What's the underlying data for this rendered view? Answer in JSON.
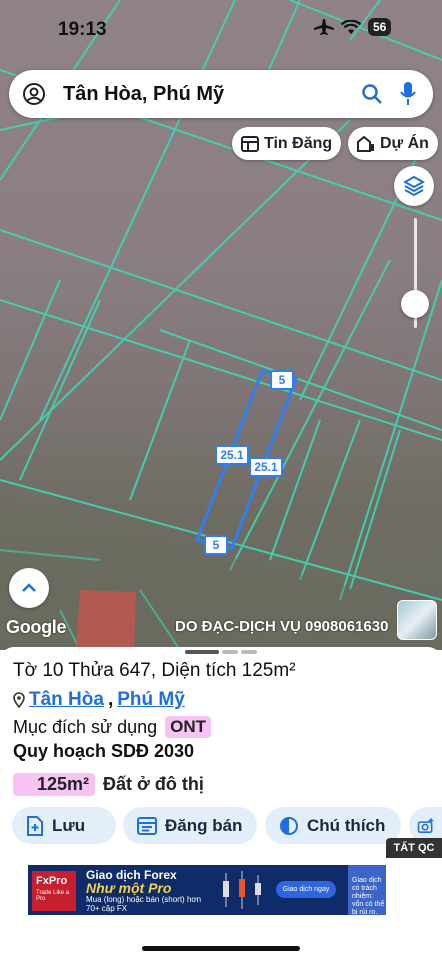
{
  "status_bar": {
    "time": "19:13",
    "battery": "56"
  },
  "search": {
    "query": "Tân Hòa, Phú Mỹ"
  },
  "chips": {
    "listings": "Tin Đăng",
    "projects": "Dự Án"
  },
  "map": {
    "parcel_labels": {
      "top": "5",
      "bottom": "5",
      "left_side": "25.1",
      "right_side": "25.1"
    },
    "google_label": "Google",
    "watermark": "DO ĐẠC-DỊCH VỤ 0908061630",
    "colors": {
      "parcel_line": "#3fd6b4",
      "selected_parcel": "#2f7ff2"
    }
  },
  "info": {
    "title": "Tờ 10 Thửa 647, Diện tích 125m²",
    "location": {
      "ward": "Tân Hòa",
      "separator": ",",
      "district": "Phú Mỹ"
    },
    "purpose_label": "Mục đích sử dụng",
    "purpose_code": "ONT",
    "plan_title": "Quy hoạch SDĐ 2030",
    "area_value": "125m²",
    "area_desc": "Đất ở đô thị"
  },
  "actions": {
    "save": "Lưu",
    "post": "Đăng bán",
    "style": "Chú thích"
  },
  "ad": {
    "close_label": "TẤT QC",
    "brand": "FxPro",
    "tagline": "Trade Like a Pro",
    "line1": "Giao dịch Forex",
    "line2": "Như một Pro",
    "line3": "Mua (long) hoặc bán (short) hơn 70+ cặp FX",
    "cta": "Giao dịch ngay",
    "disclaimer": "Giao dịch có trách nhiệm: vốn có thể bị rủi ro."
  },
  "accent": "#1f6fe0"
}
